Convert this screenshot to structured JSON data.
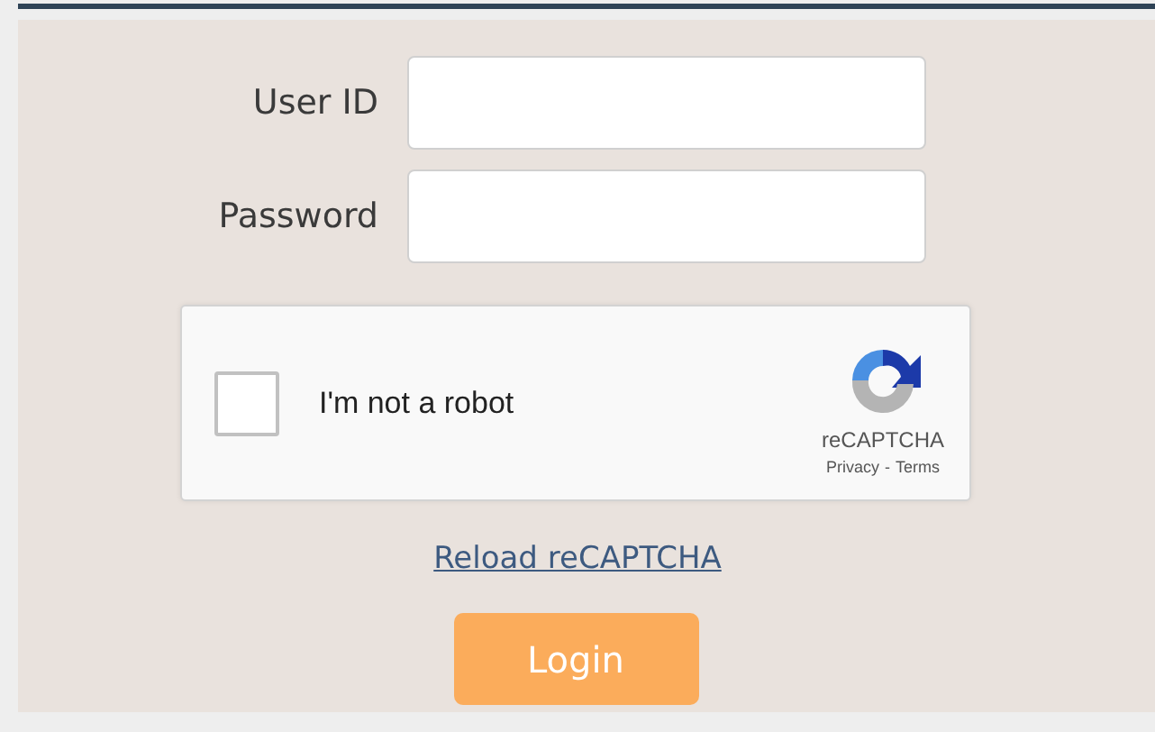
{
  "form": {
    "fields": [
      {
        "label": "User ID"
      },
      {
        "label": "Password"
      }
    ]
  },
  "captcha": {
    "label": "I'm not a robot",
    "checked": false,
    "brand": "reCAPTCHA",
    "privacy": "Privacy",
    "separator": "-",
    "terms": "Terms"
  },
  "reload_link": "Reload reCAPTCHA",
  "login_button": "Login"
}
